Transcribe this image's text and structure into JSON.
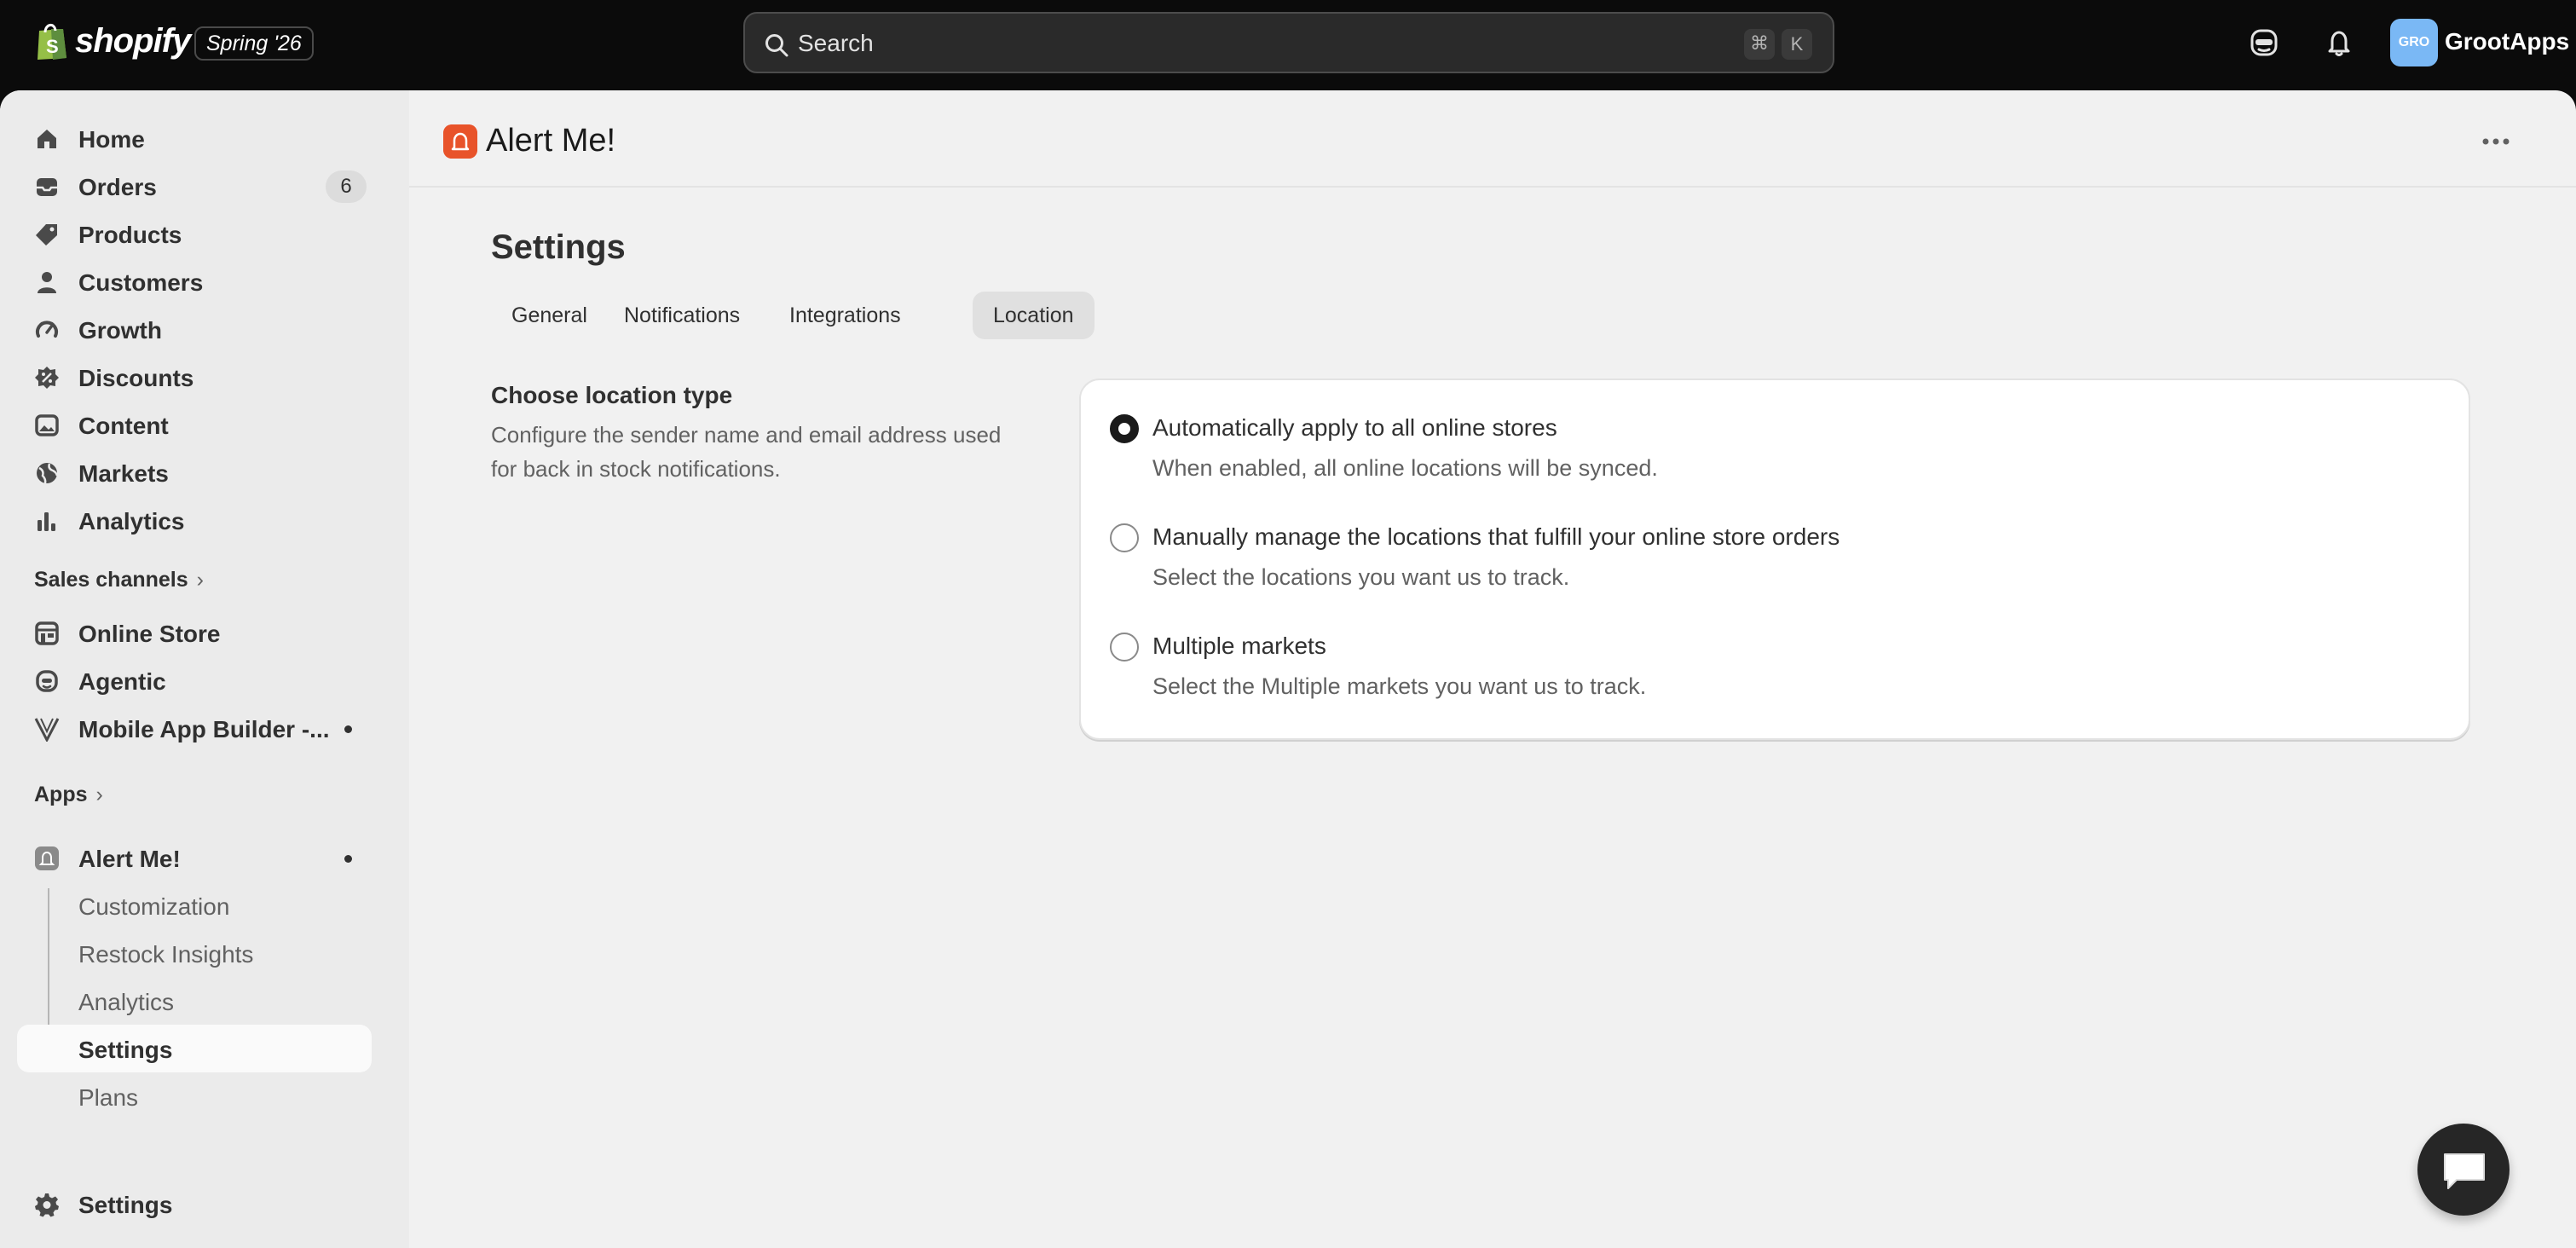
{
  "topbar": {
    "brand": "shopify",
    "edition": "Spring '26",
    "search_placeholder": "Search",
    "shortcut_cmd": "⌘",
    "shortcut_key": "K",
    "avatar_initials": "GRO",
    "store_name": "GrootApps"
  },
  "sidebar": {
    "items": [
      {
        "label": "Home",
        "icon": "home-icon"
      },
      {
        "label": "Orders",
        "icon": "orders-icon",
        "badge": "6"
      },
      {
        "label": "Products",
        "icon": "tag-icon"
      },
      {
        "label": "Customers",
        "icon": "person-icon"
      },
      {
        "label": "Growth",
        "icon": "gauge-icon"
      },
      {
        "label": "Discounts",
        "icon": "discount-icon"
      },
      {
        "label": "Content",
        "icon": "image-icon"
      },
      {
        "label": "Markets",
        "icon": "globe-icon"
      },
      {
        "label": "Analytics",
        "icon": "bar-chart-icon"
      }
    ],
    "sales_channels_label": "Sales channels",
    "sales_channels": [
      {
        "label": "Online Store",
        "icon": "store-icon"
      },
      {
        "label": "Agentic",
        "icon": "agent-icon"
      },
      {
        "label": "Mobile App Builder -...",
        "icon": "v-logo-icon"
      }
    ],
    "apps_label": "Apps",
    "app": {
      "label": "Alert Me!",
      "sub_items": [
        "Customization",
        "Restock Insights",
        "Analytics",
        "Settings",
        "Plans"
      ],
      "selected": "Settings"
    },
    "settings_label": "Settings"
  },
  "main": {
    "app_title": "Alert Me!",
    "page_title": "Settings",
    "tabs": [
      {
        "label": "General"
      },
      {
        "label": "Notifications"
      },
      {
        "label": "Integrations"
      },
      {
        "label": "Location"
      }
    ],
    "active_tab": "Location",
    "section": {
      "title": "Choose location type",
      "description": "Configure the sender name and email address used for back in stock notifications."
    },
    "options": [
      {
        "label": "Automatically apply to all online stores",
        "help": "When enabled, all online locations will be synced.",
        "checked": true
      },
      {
        "label": "Manually manage the locations that fulfill your online store orders",
        "help": "Select the locations you want us to track.",
        "checked": false
      },
      {
        "label": "Multiple markets",
        "help": "Select the Multiple markets you want us to track.",
        "checked": false
      }
    ]
  },
  "colors": {
    "topbar_bg": "#0b0b0b",
    "page_bg": "#f1f1f1",
    "sidebar_bg": "#ebebeb",
    "app_accent": "#e8532a",
    "avatar_bg": "#7ab8f5"
  }
}
